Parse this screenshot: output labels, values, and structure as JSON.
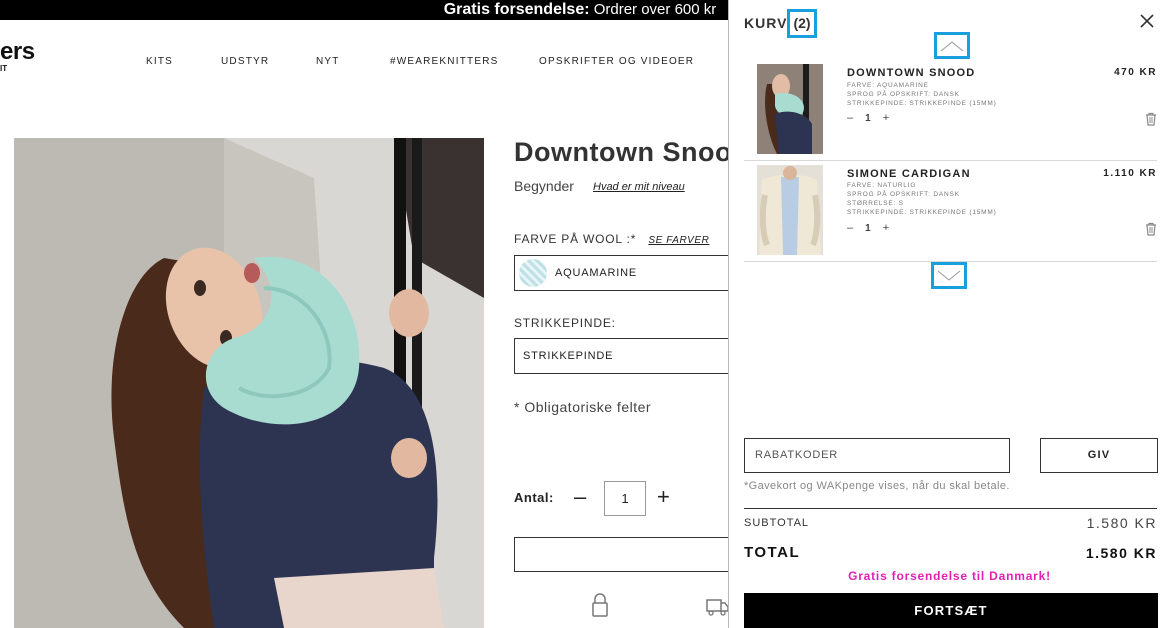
{
  "banner": {
    "bold": "Gratis forsendelse:",
    "rest": " Ordrer over 600 kr"
  },
  "logo": {
    "main": "ers",
    "sub": "IT"
  },
  "nav": [
    {
      "label": "KITS"
    },
    {
      "label": "UDSTYR"
    },
    {
      "label": "NYT"
    },
    {
      "label": "#WEAREKNITTERS"
    },
    {
      "label": "OPSKRIFTER OG VIDEOER"
    }
  ],
  "social": [
    "facebook-icon",
    "twitter-icon",
    "pinterest-icon"
  ],
  "product": {
    "title": "Downtown Snood",
    "level": "Begynder",
    "level_link": "Hvad er mit niveau",
    "color_label": "FARVE PÅ WOOL :*",
    "color_link": "SE FARVER",
    "color_value": "AQUAMARINE",
    "needle_label": "STRIKKEPINDE:",
    "needle_value": "STRIKKEPINDE",
    "required_note": "* Obligatoriske felter",
    "qty_label": "Antal:",
    "qty_value": "1",
    "minus": "–",
    "plus": "+"
  },
  "cart": {
    "title": "KURV",
    "count": "(2)",
    "items": [
      {
        "name": "DOWNTOWN SNOOD",
        "price": "470  KR",
        "meta": [
          "FARVE: AQUAMARINE",
          "SPROG PÅ OPSKRIFT: DANSK",
          "STRIKKEPINDE: STRIKKEPINDE (15MM)"
        ],
        "qty": "1"
      },
      {
        "name": "SIMONE CARDIGAN",
        "price": "1.110  KR",
        "meta": [
          "FARVE: NATURLIG",
          "SPROG PÅ OPSKRIFT: DANSK",
          "STØRRELSE: S",
          "STRIKKEPINDE: STRIKKEPINDE (15MM)"
        ],
        "qty": "1"
      }
    ],
    "coupon_placeholder": "RABATKODER",
    "apply_label": "GIV",
    "giftcard_note": "*Gavekort og WAKpenge vises, når du skal betale.",
    "subtotal_label": "SUBTOTAL",
    "subtotal_value": "1.580  KR",
    "total_label": "TOTAL",
    "total_value": "1.580  KR",
    "free_shipping": "Gratis forsendelse til Danmark!",
    "checkout_label": "FORTSÆT"
  },
  "colors": {
    "accent_pink": "#e01fb4",
    "highlight_blue": "#1a9fde",
    "swatch": "#bfe1e6"
  }
}
